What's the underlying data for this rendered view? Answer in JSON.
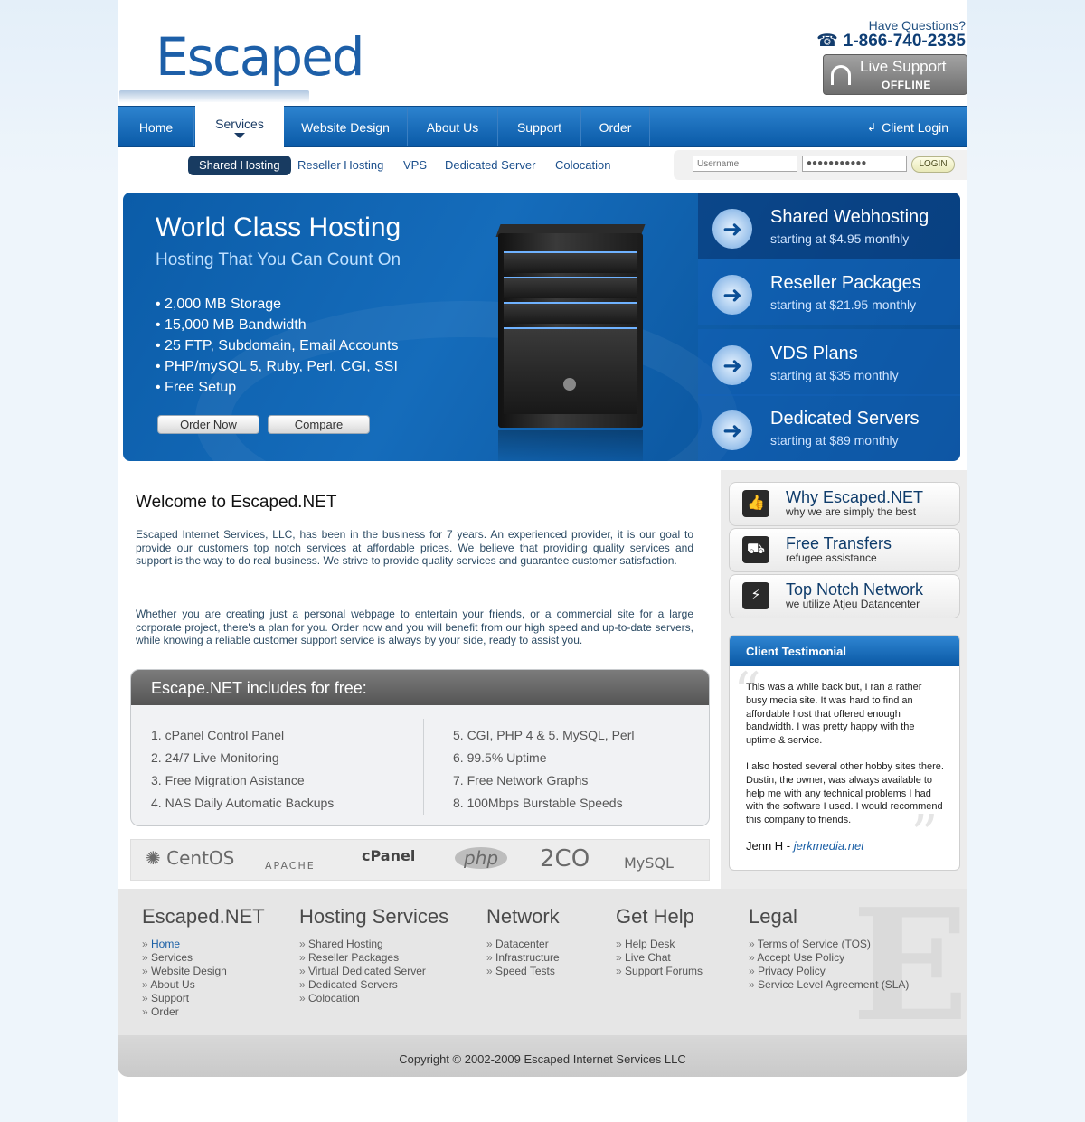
{
  "header": {
    "logo_text": "Escaped",
    "questions": "Have Questions?",
    "phone": "1-866-740-2335",
    "live_support_title": "Live Support",
    "live_support_status": "OFFLINE"
  },
  "nav": {
    "items": [
      "Home",
      "Services",
      "Website Design",
      "About Us",
      "Support",
      "Order"
    ],
    "active": "Services",
    "client_login": "Client Login"
  },
  "subnav": {
    "items": [
      "Shared Hosting",
      "Reseller Hosting",
      "VPS",
      "Dedicated Server",
      "Colocation"
    ],
    "active": "Shared Hosting"
  },
  "login": {
    "username_placeholder": "Username",
    "password_value": "●●●●●●●●●●●",
    "button": "LOGIN"
  },
  "hero": {
    "title": "World Class Hosting",
    "subtitle": "Hosting That You Can Count On",
    "features": [
      "2,000 MB Storage",
      "15,000 MB Bandwidth",
      "25 FTP, Subdomain, Email Accounts",
      "PHP/mySQL 5, Ruby, Perl, CGI, SSI",
      "Free Setup"
    ],
    "order_button": "Order Now",
    "compare_button": "Compare",
    "plans": [
      {
        "title": "Shared Webhosting",
        "price": "starting at $4.95 monthly"
      },
      {
        "title": "Reseller Packages",
        "price": "starting at $21.95 monthly"
      },
      {
        "title": "VDS Plans",
        "price": "starting at $35 monthly"
      },
      {
        "title": "Dedicated Servers",
        "price": "starting at $89 monthly"
      }
    ]
  },
  "main": {
    "welcome_title": "Welcome to Escaped.NET",
    "para1": "Escaped Internet Services, LLC, has been in the business for 7 years. An experienced provider, it is our goal to provide our customers top notch services at affordable prices. We believe that providing quality services and support is the way to do real business. We strive to provide quality services and guarantee customer satisfaction.",
    "para2": "Whether you are creating just a personal webpage to entertain your friends, or a commercial site for a large corporate project, there's a plan for you. Order now and you will benefit from our high speed and up-to-date servers, while knowing a reliable customer support service is always by your side, ready to assist you.",
    "free_title": "Escape.NET includes for free:",
    "free_left": [
      "1. cPanel Control Panel",
      "2. 24/7 Live Monitoring",
      "3. Free Migration Asistance",
      "4. NAS Daily Automatic Backups"
    ],
    "free_right": [
      "5. CGI, PHP 4 & 5. MySQL, Perl",
      "6. 99.5% Uptime",
      "7. Free Network Graphs",
      "8. 100Mbps Burstable Speeds"
    ],
    "logos": [
      "CentOS",
      "APACHE",
      "cPanel",
      "php",
      "2CO",
      "MySQL"
    ]
  },
  "sidebar": {
    "features": [
      {
        "title": "Why Escaped.NET",
        "sub": "why we are simply the best"
      },
      {
        "title": "Free Transfers",
        "sub": "refugee assistance"
      },
      {
        "title": "Top Notch Network",
        "sub": "we utilize Atjeu Datancenter"
      }
    ],
    "testimonial_title": "Client Testimonial",
    "testimonial_p1": "This was a while back but, I ran a rather busy media site. It was hard to find an affordable host that offered enough bandwidth. I was pretty happy with the uptime & service.",
    "testimonial_p2": "I also hosted several other hobby sites there. Dustin, the owner, was always available to help me with any technical problems I had with the software I used. I would recommend this company to friends.",
    "testimonial_author": "Jenn H - ",
    "testimonial_link": "jerkmedia.net"
  },
  "footer": {
    "columns": [
      {
        "title": "Escaped.NET",
        "links": [
          "Home",
          "Services",
          "Website Design",
          "About Us",
          "Support",
          "Order"
        ]
      },
      {
        "title": "Hosting Services",
        "links": [
          "Shared Hosting",
          "Reseller Packages",
          "Virtual Dedicated Server",
          "Dedicated Servers",
          "Colocation"
        ]
      },
      {
        "title": "Network",
        "links": [
          "Datacenter",
          "Infrastructure",
          "Speed Tests"
        ]
      },
      {
        "title": "Get Help",
        "links": [
          "Help Desk",
          "Live Chat",
          "Support Forums"
        ]
      },
      {
        "title": "Legal",
        "links": [
          "Terms of Service (TOS)",
          "Accept Use Policy",
          "Privacy Policy",
          "Service Level Agreement (SLA)"
        ]
      }
    ],
    "copyright": "Copyright © 2002-2009 Escaped Internet Services LLC"
  },
  "colors": {
    "brand_blue": "#0a5aa7",
    "nav_active_text": "#1b3c65",
    "page_bg": "#eef5fb"
  }
}
